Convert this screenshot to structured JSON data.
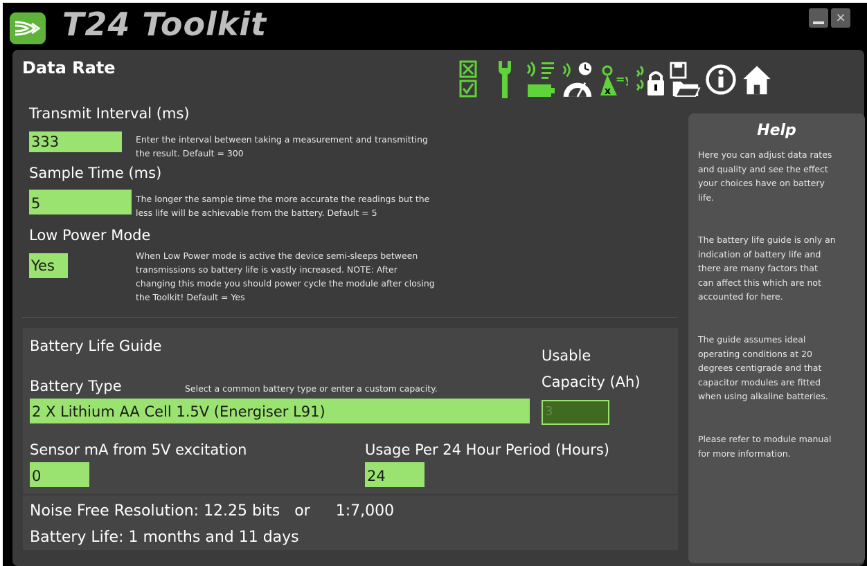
{
  "app": {
    "title": "T24 Toolkit"
  },
  "window_controls": {
    "close": "×"
  },
  "page": {
    "title": "Data Rate"
  },
  "toolbar": {
    "icons": [
      "checklist-icon",
      "wrench-icon",
      "wireless-battery-icon",
      "speedometer-icon",
      "scaling-icon",
      "wireless-lock-icon",
      "save-open-icon",
      "info-icon",
      "home-icon"
    ]
  },
  "transmit": {
    "label": "Transmit Interval (ms)",
    "value": "333",
    "help_line1": "Enter the interval between taking a measurement and transmitting",
    "help_line2": "the result. Default = 300"
  },
  "sample": {
    "label": "Sample Time (ms)",
    "value": "5",
    "help_line1": "The longer the sample time the more accurate the readings but the",
    "help_line2": "less life will be achievable from the battery. Default = 5"
  },
  "lowpower": {
    "label": "Low Power Mode",
    "value": "Yes",
    "help_line1": "When Low Power mode is active the device semi-sleeps between",
    "help_line2": "transmissions so battery life is vastly increased. NOTE: After",
    "help_line3": "changing this mode you should power cycle the module after closing",
    "help_line4": "the Toolkit! Default = Yes"
  },
  "battery": {
    "section_title": "Battery Life Guide",
    "type_label": "Battery Type",
    "type_hint": "Select a common battery type or enter a custom capacity.",
    "type_value": "2 X Lithium AA Cell 1.5V (Energiser L91)",
    "capacity_label_line1": "Usable",
    "capacity_label_line2": "Capacity (Ah)",
    "capacity_value": "3",
    "sensor_label": "Sensor mA from 5V excitation",
    "sensor_value": "0",
    "usage_label": "Usage Per 24 Hour Period (Hours)",
    "usage_value": "24"
  },
  "results": {
    "noise_label": "Noise Free Resolution:",
    "noise_bits": "12.25 bits",
    "noise_or": "or",
    "noise_ratio": "1:7,000",
    "life_label": "Battery Life:",
    "life_value": "1 months and 11 days"
  },
  "help": {
    "title": "Help",
    "p1_l1": "Here you can adjust data rates",
    "p1_l2": "and quality and see the effect",
    "p1_l3": "your choices have on battery",
    "p1_l4": "life.",
    "p2_l1": "The battery life guide is only an",
    "p2_l2": "indication of battery life and",
    "p2_l3": "there are many factors that",
    "p2_l4": "can affect this which are not",
    "p2_l5": "accounted for here.",
    "p3_l1": "The guide assumes ideal",
    "p3_l2": "operating conditions at 20",
    "p3_l3": "degrees centigrade and that",
    "p3_l4": "capacitor modules are fitted",
    "p3_l5": "when using alkaline batteries.",
    "p4_l1": "Please refer to module manual",
    "p4_l2": "for more information."
  },
  "colors": {
    "accent": "#5fd339",
    "field": "#9be370",
    "panel": "#3b3b3b",
    "help_panel": "#515151"
  }
}
